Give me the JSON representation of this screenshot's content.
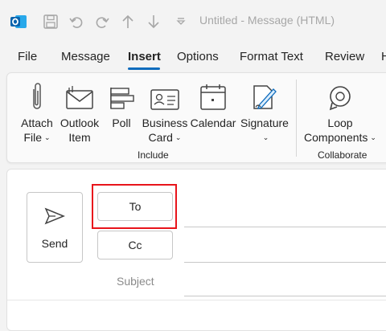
{
  "window": {
    "title": "Untitled  -  Message (HTML)"
  },
  "quick_access": {
    "icons": [
      "outlook-app-icon",
      "save-icon",
      "undo-icon",
      "redo-icon",
      "up-arrow-icon",
      "down-arrow-icon",
      "customize-qat-icon"
    ]
  },
  "tabs": [
    {
      "label": "File",
      "active": false
    },
    {
      "label": "Message",
      "active": false
    },
    {
      "label": "Insert",
      "active": true
    },
    {
      "label": "Options",
      "active": false
    },
    {
      "label": "Format Text",
      "active": false
    },
    {
      "label": "Review",
      "active": false
    },
    {
      "label": "H",
      "active": false
    }
  ],
  "ribbon": {
    "include": {
      "label": "Include",
      "buttons": [
        {
          "line1": "Attach",
          "line2": "File",
          "caret": true,
          "icon": "paperclip-icon"
        },
        {
          "line1": "Outlook",
          "line2": "Item",
          "caret": false,
          "icon": "outlook-item-icon"
        },
        {
          "line1": "Poll",
          "line2": "",
          "caret": false,
          "icon": "poll-icon"
        },
        {
          "line1": "Business",
          "line2": "Card",
          "caret": true,
          "icon": "business-card-icon"
        },
        {
          "line1": "Calendar",
          "line2": "",
          "caret": false,
          "icon": "calendar-icon"
        },
        {
          "line1": "Signature",
          "line2": "",
          "caret": true,
          "icon": "signature-icon"
        }
      ]
    },
    "collaborate": {
      "label": "Collaborate",
      "buttons": [
        {
          "line1": "Loop",
          "line2": "Components",
          "caret": true,
          "icon": "loop-icon"
        }
      ]
    }
  },
  "compose": {
    "send_label": "Send",
    "to_label": "To",
    "cc_label": "Cc",
    "subject_label": "Subject"
  },
  "colors": {
    "accent": "#0f6cbd",
    "highlight": "#e8141b",
    "outlook_brand": "#0a64ad"
  }
}
